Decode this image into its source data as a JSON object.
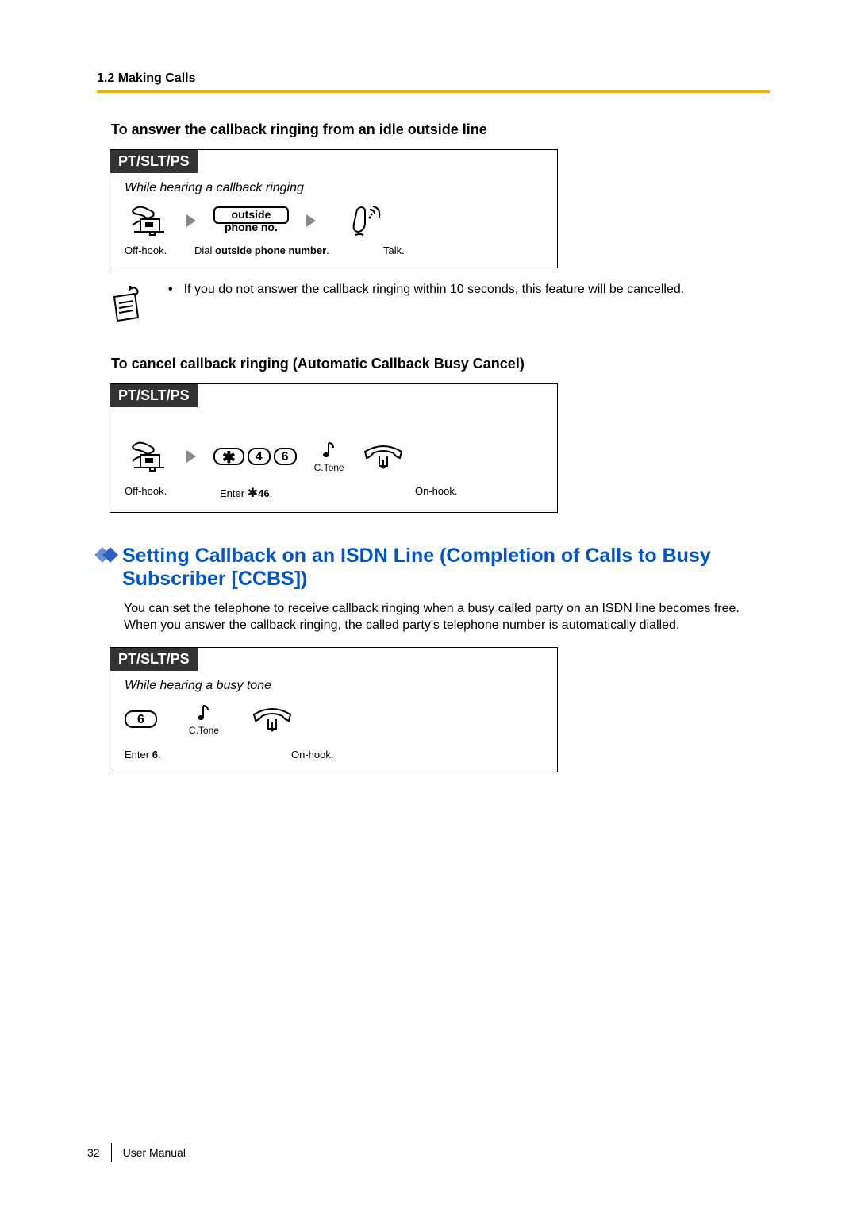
{
  "header": {
    "section": "1.2 Making Calls"
  },
  "headings": {
    "answer": "To answer the callback ringing from an idle outside line",
    "cancel": "To cancel callback ringing (Automatic Callback Busy Cancel)",
    "ccbs": "Setting Callback on an ISDN Line (Completion of Calls to Busy Subscriber [CCBS])"
  },
  "paragraphs": {
    "ccbs_intro": "You can set the telephone to receive callback ringing when a busy called party on an ISDN line becomes free.\nWhen you answer the callback ringing, the called party's telephone number is automatically dialled."
  },
  "notes": {
    "timeout": "If you do not answer the callback ringing within 10 seconds, this feature will be cancelled."
  },
  "proc1": {
    "title": "PT/SLT/PS",
    "condition": "While hearing a callback ringing",
    "box_top": "outside",
    "box_bottom": "phone no.",
    "label_offhook": "Off-hook.",
    "label_dial_a": "Dial ",
    "label_dial_b": "outside phone number",
    "label_dial_c": ".",
    "label_talk": "Talk."
  },
  "proc2": {
    "title": "PT/SLT/PS",
    "key_seq": {
      "k1": "4",
      "k2": "6"
    },
    "label_offhook": "Off-hook.",
    "label_enter_a": "Enter ",
    "label_enter_b": "46",
    "label_enter_c": ".",
    "label_ctone": "C.Tone",
    "label_onhook": "On-hook."
  },
  "proc3": {
    "title": "PT/SLT/PS",
    "condition": "While hearing a busy tone",
    "key": "6",
    "label_enter_a": "Enter ",
    "label_enter_b": "6",
    "label_enter_c": ".",
    "label_ctone": "C.Tone",
    "label_onhook": "On-hook."
  },
  "footer": {
    "page": "32",
    "label": "User Manual"
  }
}
